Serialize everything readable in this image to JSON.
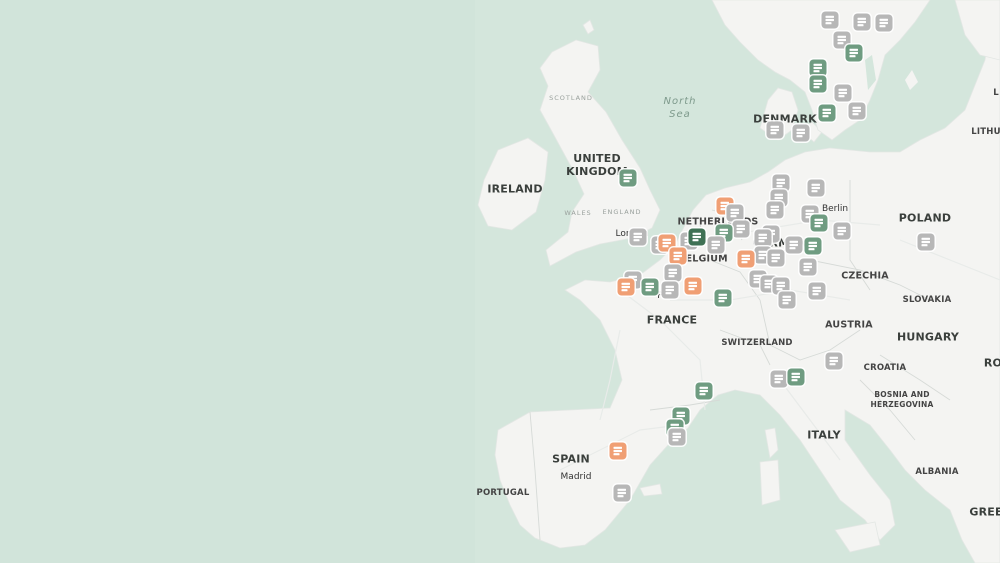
{
  "colors": {
    "sea": "#d4e6dc",
    "land": "#f4f4f2",
    "gray_pin": "#b7b7b7",
    "green_pin": "#6f9c81",
    "orange_pin": "#f09f74",
    "dark_pin": "#3f7154"
  },
  "labels": {
    "ireland": "IRELAND",
    "united_kingdom": "UNITED\nKINGDOM",
    "scotland": "SCOTLAND",
    "wales": "WALES",
    "england": "ENGLAND",
    "london": "London",
    "north_sea": "North\nSea",
    "denmark": "DENMARK",
    "netherlands": "NETHERLANDS",
    "belgium": "BELGIUM",
    "germany": "GERMANY",
    "berlin": "Berlin",
    "poland": "POLAND",
    "czechia": "CZECHIA",
    "slovakia": "SLOVAKIA",
    "austria": "AUSTRIA",
    "hungary": "HUNGARY",
    "switzerland": "SWITZERLAND",
    "croatia": "CROATIA",
    "bosnia": "BOSNIA AND\nHERZEGOVINA",
    "paris": "Paris",
    "france": "FRANCE",
    "italy": "ITALY",
    "spain": "SPAIN",
    "madrid": "Madrid",
    "portugal": "PORTUGAL",
    "albania": "ALBANIA",
    "greece_partial": "GREE",
    "romania_partial": "RO",
    "lithuania_partial": "LITHU",
    "latvia_partial": "L"
  },
  "pin_icon": "charging-station-icon",
  "pin_counts": {
    "gray": 52,
    "green": 17,
    "orange": 9,
    "dark": 1
  }
}
